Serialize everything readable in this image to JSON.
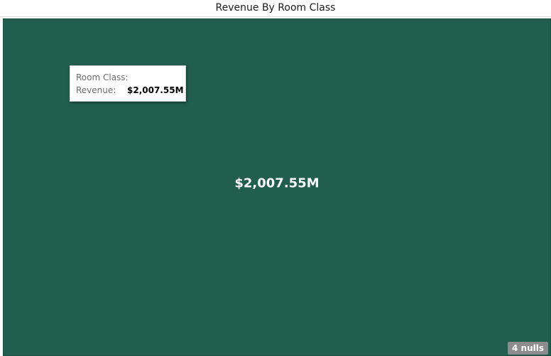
{
  "header": {
    "title": "Revenue By Room Class"
  },
  "chart_data": {
    "type": "treemap",
    "title": "Revenue By Room Class",
    "cells": [
      {
        "category": "",
        "value": 2007.55,
        "label": "$2,007.55M",
        "color": "#225e4e"
      }
    ],
    "nulls_label": "4 nulls"
  },
  "tooltip": {
    "category_label": "Room Class:",
    "category_value": "",
    "value_label": "Revenue:",
    "value_text": "$2,007.55M"
  },
  "colors": {
    "cell": "#225e4e",
    "cell_border": "#1a3f35",
    "badge": "#8c8c8c"
  }
}
